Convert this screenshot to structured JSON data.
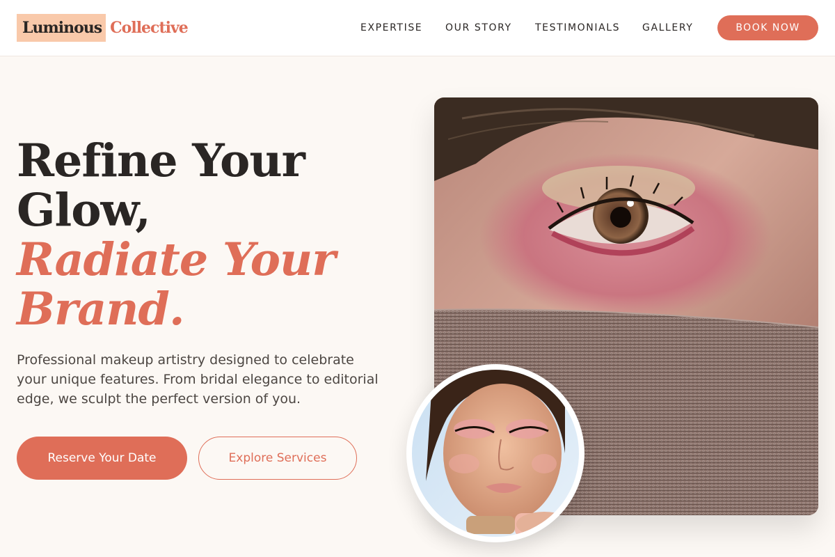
{
  "header": {
    "logo": {
      "part1": "Luminous",
      "part2": "Collective"
    },
    "nav": [
      "EXPERTISE",
      "OUR STORY",
      "TESTIMONIALS",
      "GALLERY"
    ],
    "cta": "BOOK NOW"
  },
  "hero": {
    "headline_line1": "Refine Your",
    "headline_line2": "Glow,",
    "headline_accent1": "Radiate Your",
    "headline_accent2": "Brand.",
    "description": "Professional makeup artistry designed to celebrate your unique features. From bridal elegance to editorial edge, we sculpt the perfect version of you.",
    "primary_button": "Reserve Your Date",
    "secondary_button": "Explore Services"
  },
  "images": {
    "main": "eye-closeup-photo",
    "inset": "portrait-photo"
  },
  "colors": {
    "accent": "#df6e58",
    "logo_highlight": "#f9c9aa",
    "background": "#fcf8f4",
    "text": "#2a2624"
  }
}
